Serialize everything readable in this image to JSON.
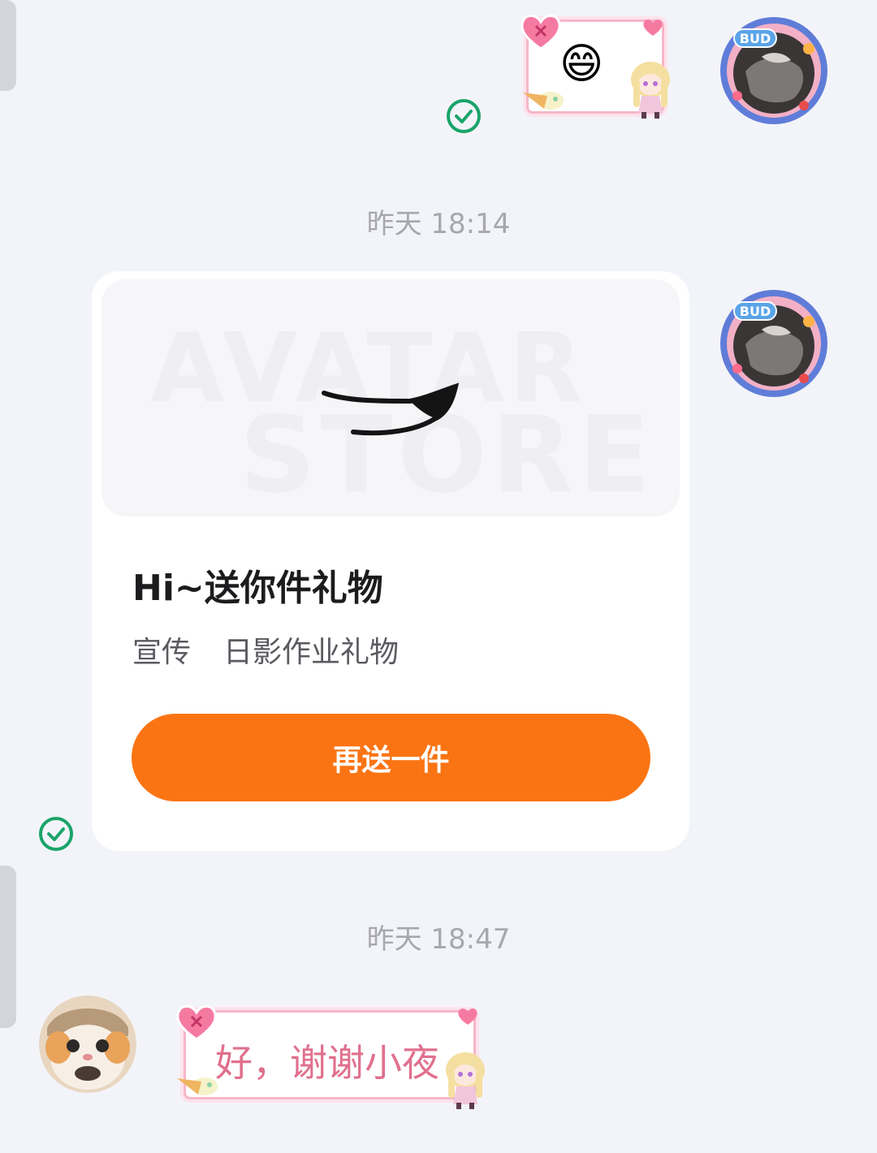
{
  "timestamps": [
    "昨天 18:14",
    "昨天 18:47"
  ],
  "sent_emoji": "😄",
  "gift_card": {
    "title": "Hi~送你件礼物",
    "tag": "宣传",
    "item_name": "日影作业礼物",
    "resend_label": "再送一件",
    "watermark_line1": "AVATAR",
    "watermark_line2": "STORE"
  },
  "incoming_message": {
    "text": "好，谢谢小夜"
  },
  "avatar_badge": "BUD",
  "colors": {
    "background": "#f3f4f9",
    "accent_button": "#fb7413",
    "read_check": "#1aa46a",
    "bubble_text": "#e0708d",
    "timestamp": "#a7a8ae"
  }
}
